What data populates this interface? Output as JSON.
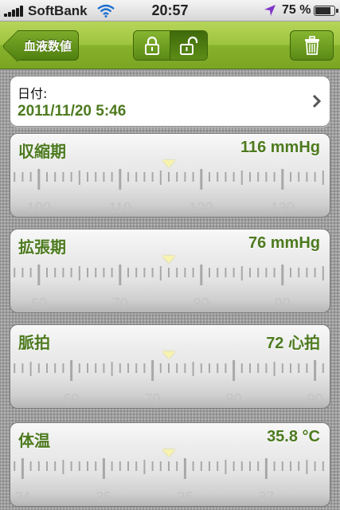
{
  "status_bar": {
    "carrier": "SoftBank",
    "time": "20:57",
    "battery_percent": "75 %",
    "battery_level": 0.75,
    "icons": [
      "signal-icon",
      "wifi-icon",
      "location-arrow-icon",
      "battery-icon"
    ]
  },
  "navbar": {
    "back_label": "血液数値",
    "segment": [
      "lock-closed-icon",
      "lock-open-icon"
    ],
    "trash_icon": "trash-icon",
    "accent_color": "#8cb833"
  },
  "date": {
    "label": "日付:",
    "value": "2011/11/20 5:46"
  },
  "measurements": [
    {
      "name": "収縮期",
      "reading": "116 mmHg",
      "ticks": [
        "100",
        "110",
        "120",
        "130"
      ],
      "tick_values": [
        100,
        110,
        120,
        130
      ],
      "value": 116
    },
    {
      "name": "拡張期",
      "reading": "76 mmHg",
      "ticks": [
        "60",
        "70",
        "80",
        "90"
      ],
      "tick_values": [
        60,
        70,
        80,
        90
      ],
      "value": 76
    },
    {
      "name": "脈拍",
      "reading": "72 心拍",
      "ticks": [
        "60",
        "70",
        "80",
        "90"
      ],
      "tick_values": [
        60,
        70,
        80,
        90
      ],
      "value": 72
    },
    {
      "name": "体温",
      "reading": "35.8 °C",
      "ticks": [
        "34",
        "35",
        "36",
        "37"
      ],
      "tick_values": [
        34,
        35,
        36,
        37
      ],
      "value": 35.8
    }
  ],
  "colors": {
    "value_green": "#4d7a1f",
    "tick_label_gray": "#c3c3c3",
    "pointer_yellow": "#f6f2b0"
  }
}
